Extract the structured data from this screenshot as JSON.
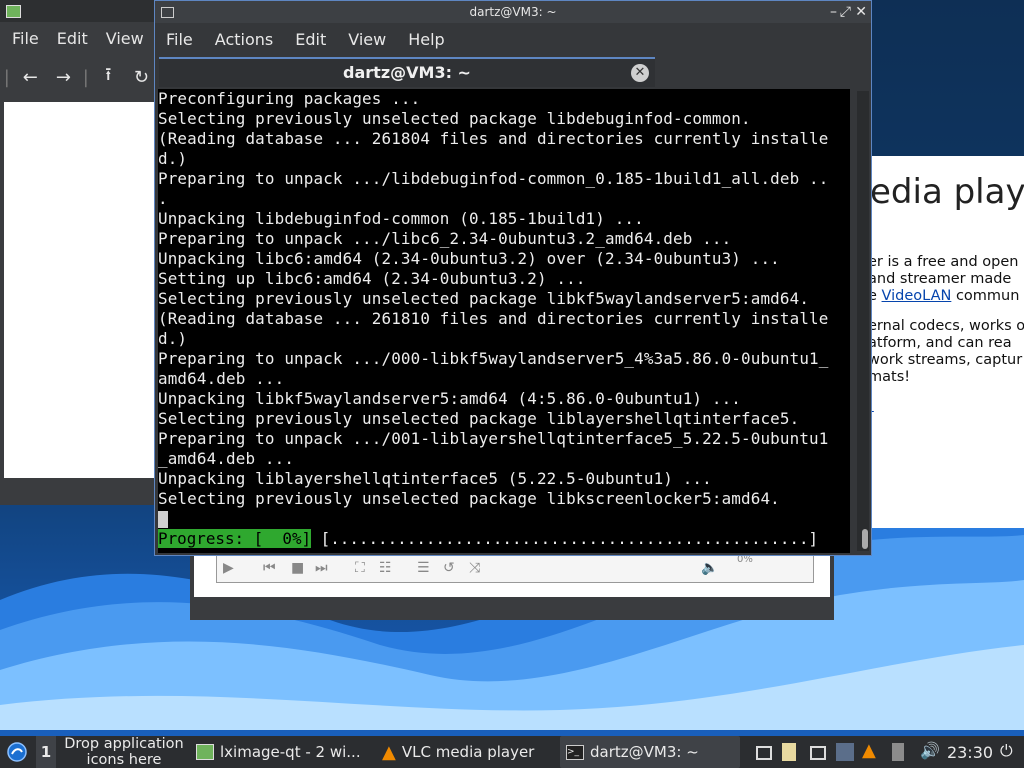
{
  "lximage": {
    "menu": [
      "File",
      "Edit",
      "View"
    ]
  },
  "webpage": {
    "hero": "edia playe",
    "lines": [
      "er is a free and open",
      " and streamer made",
      "e ",
      "VideoLAN",
      " commun",
      "ernal codecs, works o",
      "atform, and can rea",
      "work streams, captur",
      "mats!",
      "!"
    ]
  },
  "vlc": {
    "volume": "0%"
  },
  "terminal": {
    "title": "dartz@VM3: ~",
    "menu": [
      "File",
      "Actions",
      "Edit",
      "View",
      "Help"
    ],
    "tab_title": "dartz@VM3: ~",
    "lines": [
      "Preconfiguring packages ...",
      "Selecting previously unselected package libdebuginfod-common.",
      "(Reading database ... 261804 files and directories currently installe",
      "d.)",
      "Preparing to unpack .../libdebuginfod-common_0.185-1build1_all.deb ..",
      ".",
      "Unpacking libdebuginfod-common (0.185-1build1) ...",
      "Preparing to unpack .../libc6_2.34-0ubuntu3.2_amd64.deb ...",
      "Unpacking libc6:amd64 (2.34-0ubuntu3.2) over (2.34-0ubuntu3) ...",
      "Setting up libc6:amd64 (2.34-0ubuntu3.2) ...",
      "Selecting previously unselected package libkf5waylandserver5:amd64.",
      "(Reading database ... 261810 files and directories currently installe",
      "d.)",
      "Preparing to unpack .../000-libkf5waylandserver5_4%3a5.86.0-0ubuntu1_",
      "amd64.deb ...",
      "Unpacking libkf5waylandserver5:amd64 (4:5.86.0-0ubuntu1) ...",
      "Selecting previously unselected package liblayershellqtinterface5.",
      "Preparing to unpack .../001-liblayershellqtinterface5_5.22.5-0ubuntu1",
      "_amd64.deb ...",
      "Unpacking liblayershellqtinterface5 (5.22.5-0ubuntu1) ...",
      "Selecting previously unselected package libkscreenlocker5:amd64."
    ],
    "progress_label": "Progress: [  0%]",
    "progress_bar": " [..................................................]"
  },
  "taskbar": {
    "desktop_number": "1",
    "drop_text_1": "Drop application",
    "drop_text_2": "icons here",
    "tasks": [
      {
        "label": "lximage-qt - 2 wi..."
      },
      {
        "label": "VLC media player"
      },
      {
        "label": "dartz@VM3: ~"
      }
    ],
    "clock": "23:30"
  }
}
